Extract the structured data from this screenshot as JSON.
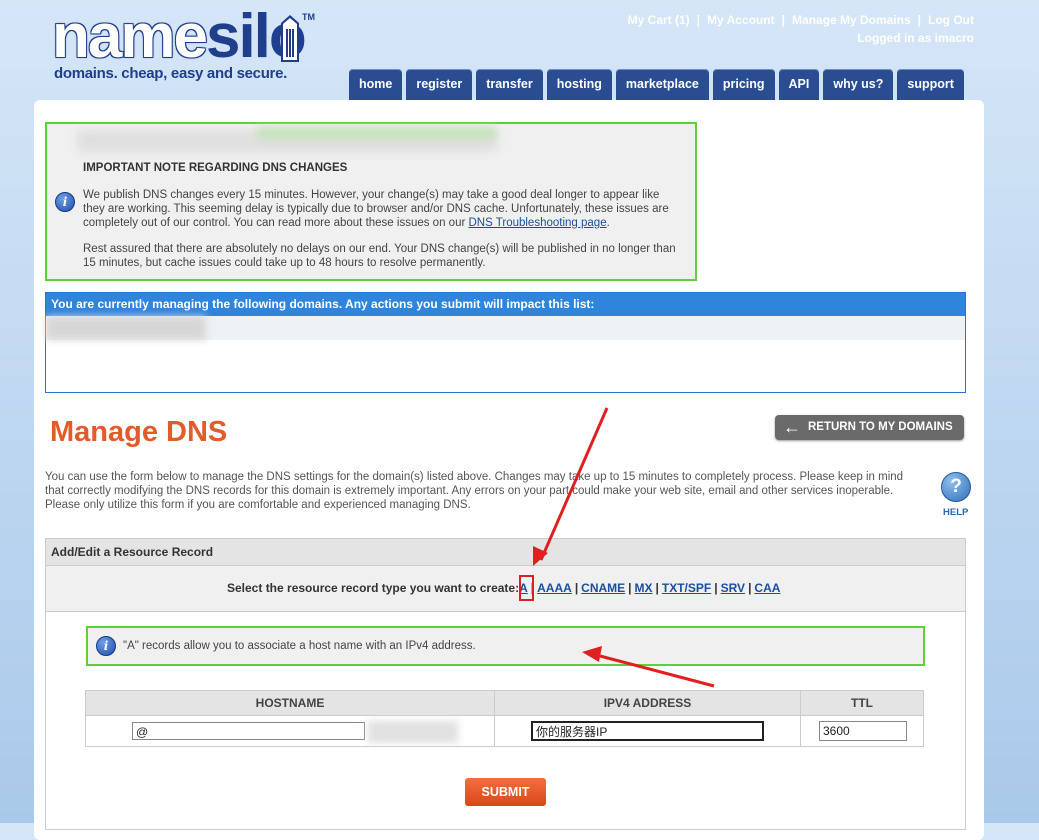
{
  "brand": {
    "logo_text_1": "name",
    "logo_text_2": "silo",
    "trademark": "TM",
    "tagline": "domains. cheap, easy and secure."
  },
  "top_links": {
    "cart": "My Cart (1)",
    "account": "My Account",
    "manage_domains": "Manage My Domains",
    "logout": "Log Out",
    "logged_in": "Logged in as imacro"
  },
  "tabs": [
    {
      "label": "home"
    },
    {
      "label": "register"
    },
    {
      "label": "transfer"
    },
    {
      "label": "hosting"
    },
    {
      "label": "marketplace"
    },
    {
      "label": "pricing"
    },
    {
      "label": "API"
    },
    {
      "label": "why us?"
    },
    {
      "label": "support"
    }
  ],
  "dns_note": {
    "title": "IMPORTANT NOTE REGARDING DNS CHANGES",
    "p1_before_link": "We publish DNS changes every 15 minutes. However, your change(s) may take a good deal longer to appear like they are working. This seeming delay is typically due to browser and/or DNS cache. Unfortunately, these issues are completely out of our control. You can read more about these issues on our ",
    "p1_link": "DNS Troubleshooting page",
    "p1_after_link": ".",
    "p2": "Rest assured that there are absolutely no delays on our end. Your DNS change(s) will be published in no longer than 15 minutes, but cache issues could take up to 48 hours to resolve permanently."
  },
  "managing": {
    "header": "You are currently managing the following domains. Any actions you submit will impact this list:"
  },
  "page": {
    "title": "Manage DNS",
    "return_button": "RETURN TO MY DOMAINS",
    "description": "You can use the form below to manage the DNS settings for the domain(s) listed above. Changes may take up to 15 minutes to completely process. Please keep in mind that correctly modifying the DNS records for this domain is extremely important. Any errors on your part could make your web site, email and other services inoperable. Please only utilize this form if you are comfortable and experienced managing DNS.",
    "help_label": "HELP"
  },
  "resource_record": {
    "header": "Add/Edit a Resource Record",
    "prompt": "Select the resource record type you want to create:",
    "types": [
      "A",
      "AAAA",
      "CNAME",
      "MX",
      "TXT/SPF",
      "SRV",
      "CAA"
    ],
    "selected": "A",
    "info": "\"A\" records allow you to associate a host name with an IPv4 address."
  },
  "record_table": {
    "columns": [
      "HOSTNAME",
      "IPV4 ADDRESS",
      "TTL"
    ],
    "hostname_value": "@",
    "ipv4_value": "你的服务器IP",
    "ttl_value": "3600"
  },
  "submit_label": "SUBMIT",
  "colors": {
    "brand_blue": "#1f3f8c",
    "tab_blue": "#2a4d92",
    "header_blue": "#2f84dc",
    "title_orange": "#e25b2a",
    "highlight_green": "#5fcf3b",
    "annotation_red": "#e02020"
  }
}
